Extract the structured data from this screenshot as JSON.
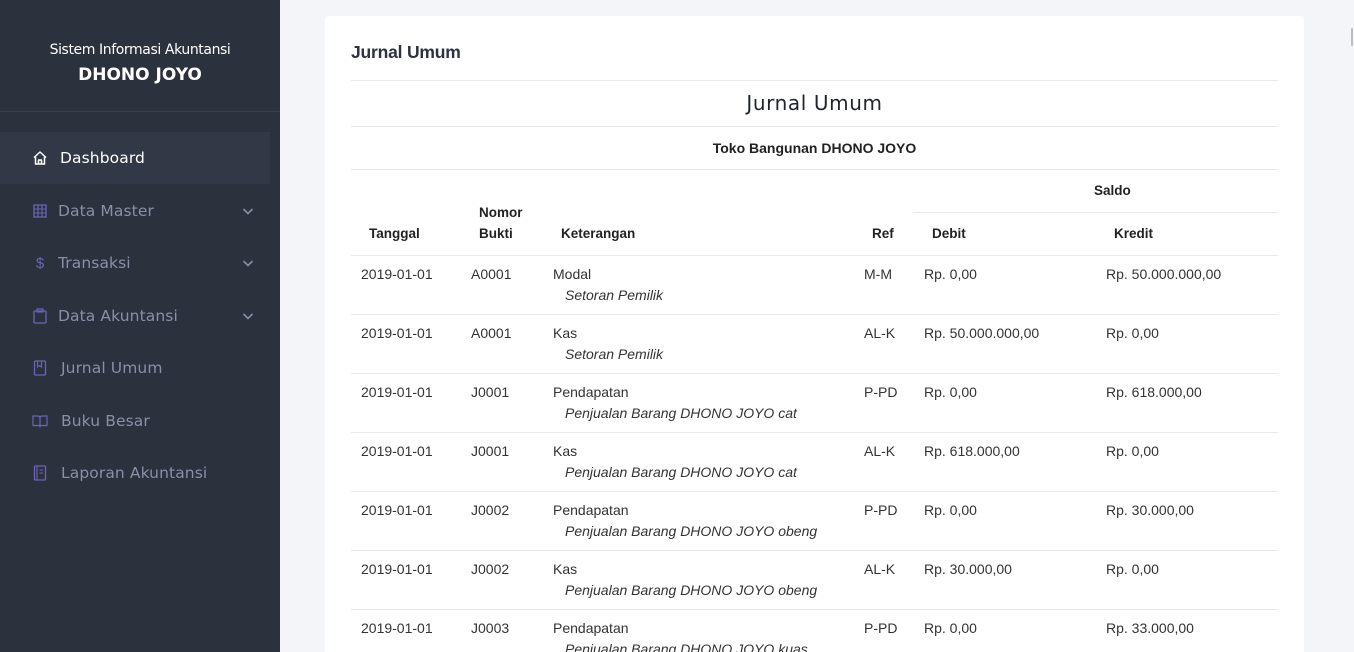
{
  "brand": {
    "subtitle": "Sistem Informasi Akuntansi",
    "name": "DHONO JOYO"
  },
  "menu": [
    {
      "label": "Dashboard",
      "icon": "home-icon"
    },
    {
      "label": "Data Master",
      "icon": "grid-icon"
    },
    {
      "label": "Transaksi",
      "icon": "dollar-icon"
    },
    {
      "label": "Data Akuntansi",
      "icon": "clipboard-icon"
    },
    {
      "label": "Jurnal Umum",
      "icon": "book-icon"
    },
    {
      "label": "Buku Besar",
      "icon": "open-book-icon"
    },
    {
      "label": "Laporan Akuntansi",
      "icon": "report-icon"
    }
  ],
  "page": {
    "card_title": "Jurnal Umum",
    "report_title": "Jurnal Umum",
    "company": "Toko Bangunan DHONO JOYO"
  },
  "table": {
    "headers": {
      "tanggal": "Tanggal",
      "nomor_1": "Nomor",
      "nomor_2": "Bukti",
      "keterangan": "Keterangan",
      "ref": "Ref",
      "saldo": "Saldo",
      "debit": "Debit",
      "kredit": "Kredit"
    },
    "rows": [
      {
        "tanggal": "2019-01-01",
        "bukti": "A0001",
        "akun": "Modal",
        "keterangan": "Setoran Pemilik",
        "ref": "M-M",
        "debit": "Rp. 0,00",
        "kredit": "Rp. 50.000.000,00"
      },
      {
        "tanggal": "2019-01-01",
        "bukti": "A0001",
        "akun": "Kas",
        "keterangan": "Setoran Pemilik",
        "ref": "AL-K",
        "debit": "Rp. 50.000.000,00",
        "kredit": "Rp. 0,00"
      },
      {
        "tanggal": "2019-01-01",
        "bukti": "J0001",
        "akun": "Pendapatan",
        "keterangan": "Penjualan Barang DHONO JOYO cat",
        "ref": "P-PD",
        "debit": "Rp. 0,00",
        "kredit": "Rp. 618.000,00"
      },
      {
        "tanggal": "2019-01-01",
        "bukti": "J0001",
        "akun": "Kas",
        "keterangan": "Penjualan Barang DHONO JOYO cat",
        "ref": "AL-K",
        "debit": "Rp. 618.000,00",
        "kredit": "Rp. 0,00"
      },
      {
        "tanggal": "2019-01-01",
        "bukti": "J0002",
        "akun": "Pendapatan",
        "keterangan": "Penjualan Barang DHONO JOYO obeng",
        "ref": "P-PD",
        "debit": "Rp. 0,00",
        "kredit": "Rp. 30.000,00"
      },
      {
        "tanggal": "2019-01-01",
        "bukti": "J0002",
        "akun": "Kas",
        "keterangan": "Penjualan Barang DHONO JOYO obeng",
        "ref": "AL-K",
        "debit": "Rp. 30.000,00",
        "kredit": "Rp. 0,00"
      },
      {
        "tanggal": "2019-01-01",
        "bukti": "J0003",
        "akun": "Pendapatan",
        "keterangan": "Penjualan Barang DHONO JOYO kuas",
        "ref": "P-PD",
        "debit": "Rp. 0,00",
        "kredit": "Rp. 33.000,00"
      }
    ]
  }
}
